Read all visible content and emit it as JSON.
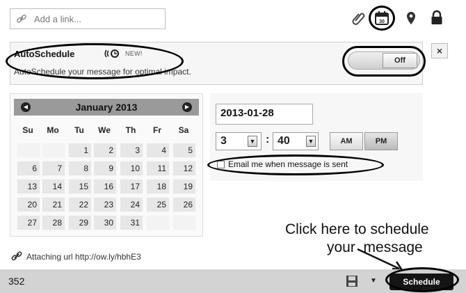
{
  "composer": {
    "link_placeholder": "Add a link..."
  },
  "top_icons": [
    "paperclip-icon",
    "calendar-icon",
    "location-pin-icon",
    "lock-icon"
  ],
  "autoschedule": {
    "title": "AutoSchedule",
    "badge": "NEW!",
    "description": "AutoSchedule your message for optimal impact.",
    "toggle_label": "Off",
    "close_label": "×"
  },
  "calendar": {
    "month_label": "January 2013",
    "weekdays": [
      "Su",
      "Mo",
      "Tu",
      "We",
      "Th",
      "Fr",
      "Sa"
    ],
    "weeks": [
      [
        "",
        "",
        "1",
        "2",
        "3",
        "4",
        "5"
      ],
      [
        "6",
        "7",
        "8",
        "9",
        "10",
        "11",
        "12"
      ],
      [
        "13",
        "14",
        "15",
        "16",
        "17",
        "18",
        "19"
      ],
      [
        "20",
        "21",
        "22",
        "23",
        "24",
        "25",
        "26"
      ],
      [
        "27",
        "28",
        "29",
        "30",
        "31",
        "",
        ""
      ]
    ]
  },
  "schedule": {
    "date": "2013-01-28",
    "hour": "3",
    "minute": "40",
    "am_label": "AM",
    "pm_label": "PM",
    "selected_period": "PM",
    "email_label": "Email me when message is sent"
  },
  "annotation": {
    "line1": "Click here to schedule",
    "line2": "your  message"
  },
  "attachment": {
    "text": "Attaching url http://ow.ly/hbhE3"
  },
  "footer": {
    "char_count": "352",
    "schedule_label": "Schedule"
  },
  "colors": {
    "bottom_bar": "#d3d3d3",
    "schedule_button": "#151515",
    "calendar_header": "#9a9a9a"
  }
}
